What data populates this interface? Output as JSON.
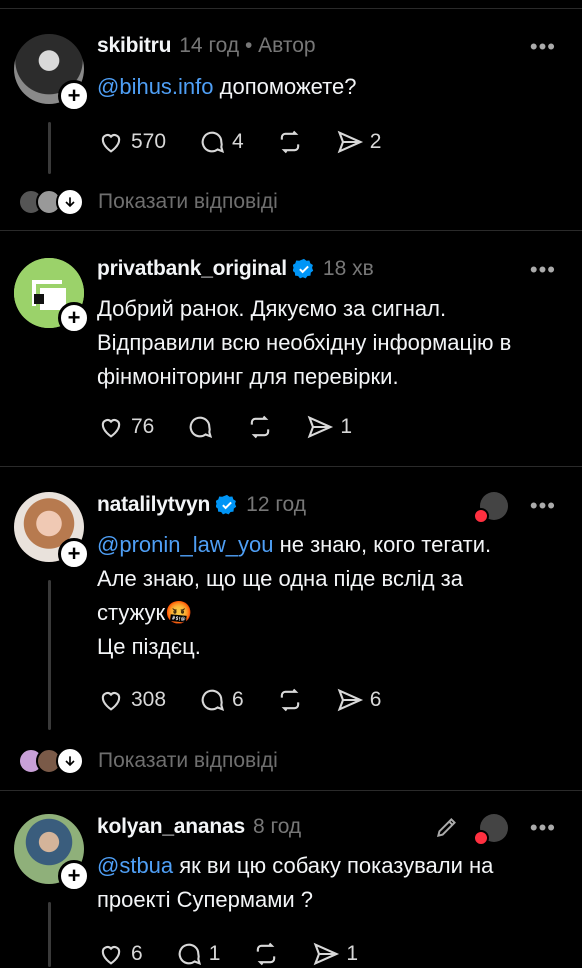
{
  "posts": [
    {
      "username": "skibitru",
      "meta": "14 год • Автор",
      "mention": "@bihus.info",
      "text_rest": " допоможете?",
      "likes": "570",
      "comments": "4",
      "shares": "2",
      "show_replies": "Показати відповіді"
    },
    {
      "username": "privatbank_original",
      "meta": "18 хв",
      "text": "Добрий ранок. Дякуємо за сигнал. Відправили всю необхідну інформацію в фінмоніторинг для перевірки.",
      "likes": "76",
      "shares": "1"
    },
    {
      "username": "natalilytvyn",
      "meta": "12 год",
      "mention": "@pronin_law_you",
      "text_rest": " не знаю, кого тегати.",
      "line2": "Але знаю, що ще одна піде вслід за",
      "line3": "стужук",
      "emoji": "🤬",
      "line4": "Це піздєц.",
      "likes": "308",
      "comments": "6",
      "shares": "6",
      "show_replies": "Показати відповіді"
    },
    {
      "username": "kolyan_ananas",
      "meta": "8 год",
      "mention": "@stbua",
      "text_rest": " як ви цю собаку показували  на",
      "line2": "проекті Супермами ?",
      "likes": "6",
      "comments": "1",
      "shares": "1"
    }
  ],
  "icons": {
    "more": "more-icon",
    "like": "heart-icon",
    "comment": "comment-icon",
    "repost": "repost-icon",
    "share": "share-icon",
    "follow": "plus-icon",
    "verified": "verified-icon"
  },
  "colors": {
    "background": "#000000",
    "text": "#f3f5f7",
    "muted": "#777777",
    "mention": "#4f9ff5",
    "verified": "#0095f6"
  }
}
